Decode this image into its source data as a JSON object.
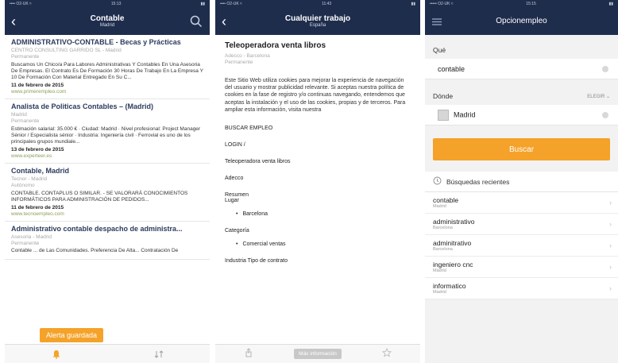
{
  "panel1": {
    "status": {
      "carrier": "•••• O2-UK ≈",
      "time": "15:13"
    },
    "nav": {
      "title": "Contable",
      "subtitle": "Madrid"
    },
    "jobs": [
      {
        "title": "ADMINISTRATIVO-CONTABLE - Becas y Prácticas",
        "company": "CENTRO CONSULTING GARRIDO SL - Madrid",
        "type": "Permanente",
        "desc": "Buscamos Un Chico/a Para Labores Administrativas Y Contables En Una Asesoria De Empresas. El Contrato Es De Formación 30 Horas De Trabajo En La Empresa Y 10 De Formación Con Material Entregado En Su C...",
        "date": "11 de febrero de 2015",
        "site": "www.primerempleo.com"
      },
      {
        "title": "Analista de Politicas Contables – (Madrid)",
        "company": "Madrid",
        "type": "Permanente",
        "desc": "Estimación salarial: 35.000 € · Ciudad: Madrid · Nivel profesional: Project Manager Sénior / Especialista sénior · Industria: Ingeniería civil · Ferrovial es uno de los principales grupos mundiale...",
        "date": "13 de febrero de 2015",
        "site": "www.experteer.es"
      },
      {
        "title": "Contable, Madrid",
        "company": "Tecnor - Madrid",
        "type": "Autónomo",
        "desc": "CONTABLE. CONTAPLUS O SIMILAR. - SE VALORARÁ CONOCIMIENTOS INFORMÁTICOS PARA ADMINISTRACIÓN DE PEDIDOS...",
        "date": "11 de febrero de 2015",
        "site": "www.tecnoempleo.com"
      },
      {
        "title": "Administrativo contable despacho de administra...",
        "company": "Asesoria - Madrid",
        "type": "Permanente",
        "desc": "Contable ... de Las Comunidades. Preferencia De Alta... Contratación De",
        "date": "",
        "site": ""
      }
    ],
    "toast": "Alerta guardada"
  },
  "panel2": {
    "status": {
      "carrier": "•••• O2-UK ≈",
      "time": "11:43"
    },
    "nav": {
      "title": "Cualquier trabajo",
      "subtitle": "España"
    },
    "job_title": "Teleoperadora venta libros",
    "company": "Adecco - Barcelona",
    "type": "Permanente",
    "cookie_text": "Este Sitio Web utiliza cookies para mejorar la experiencia de navegación del usuario y mostrar publicidad relevante. Si aceptas nuestra política de cookies en la fase de registro y/o continuas navegando, entendemos que aceptas la instalación y el uso de las cookies, propias y de terceros. Para ampliar esta información, visita nuestra",
    "items": [
      "BUSCAR EMPLEO",
      "LOGIN /",
      "Teleoperadora venta libros",
      "Adecco"
    ],
    "resumen": "Resumen",
    "lugar": "Lugar",
    "lugar_value": "Barcelona",
    "categoria": "Categoría",
    "categoria_value": "Comercial ventas",
    "tipo": "Industria Tipo de contrato",
    "more_button": "Más información"
  },
  "panel3": {
    "status": {
      "carrier": "••••• O2-UK ≈",
      "time": "15:15"
    },
    "nav": {
      "title": "Opcionempleo"
    },
    "que_label": "Qué",
    "que_value": "contable",
    "donde_label": "Dónde",
    "elegir": "ELEGIR",
    "donde_value": "Madrid",
    "search_button": "Buscar",
    "recent_label": "Búsquedas recientes",
    "recent": [
      {
        "query": "contable",
        "location": "Madrid"
      },
      {
        "query": "administrativo",
        "location": "Barcelona"
      },
      {
        "query": "adminitrativo",
        "location": "Barcelona"
      },
      {
        "query": "ingeniero cnc",
        "location": "Madrid"
      },
      {
        "query": "informatico",
        "location": "Madrid"
      }
    ]
  },
  "colors": {
    "navy": "#1f2d4d",
    "accent": "#f5a22a",
    "link_green": "#8aa05a"
  },
  "icons": [
    "back-arrow-icon",
    "search-icon",
    "bell-icon",
    "sort-icon",
    "share-icon",
    "star-icon",
    "menu-icon",
    "clock-icon",
    "chevron-right-icon"
  ]
}
